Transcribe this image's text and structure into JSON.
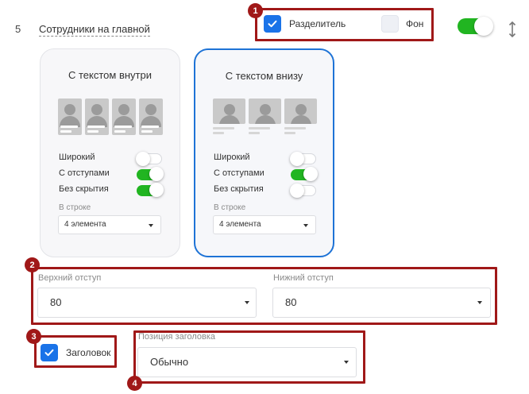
{
  "row": {
    "number": "5",
    "title": "Сотрудники на главной"
  },
  "top_options": {
    "divider": {
      "label": "Разделитель",
      "checked": true
    },
    "background": {
      "label": "Фон",
      "checked": false
    },
    "enabled": true
  },
  "cards": [
    {
      "title": "С текстом внутри",
      "options": [
        {
          "label": "Широкий",
          "on": false
        },
        {
          "label": "С отступами",
          "on": true
        },
        {
          "label": "Без скрытия",
          "on": true
        }
      ],
      "per_row_label": "В строке",
      "per_row_value": "4 элемента",
      "selected": false
    },
    {
      "title": "С текстом внизу",
      "options": [
        {
          "label": "Широкий",
          "on": false
        },
        {
          "label": "С отступами",
          "on": true
        },
        {
          "label": "Без скрытия",
          "on": false
        }
      ],
      "per_row_label": "В строке",
      "per_row_value": "4 элемента",
      "selected": true
    }
  ],
  "padding": {
    "top_label": "Верхний отступ",
    "top_value": "80",
    "bottom_label": "Нижний отступ",
    "bottom_value": "80"
  },
  "heading": {
    "label": "Заголовок",
    "checked": true
  },
  "heading_position": {
    "label": "Позиция заголовка",
    "value": "Обычно"
  },
  "annotations": [
    "1",
    "2",
    "3",
    "4"
  ],
  "colors": {
    "accent": "#1a73e8",
    "toggle_on": "#21b521",
    "annotation": "#a01818",
    "card_selected_border": "#1e73d6"
  }
}
